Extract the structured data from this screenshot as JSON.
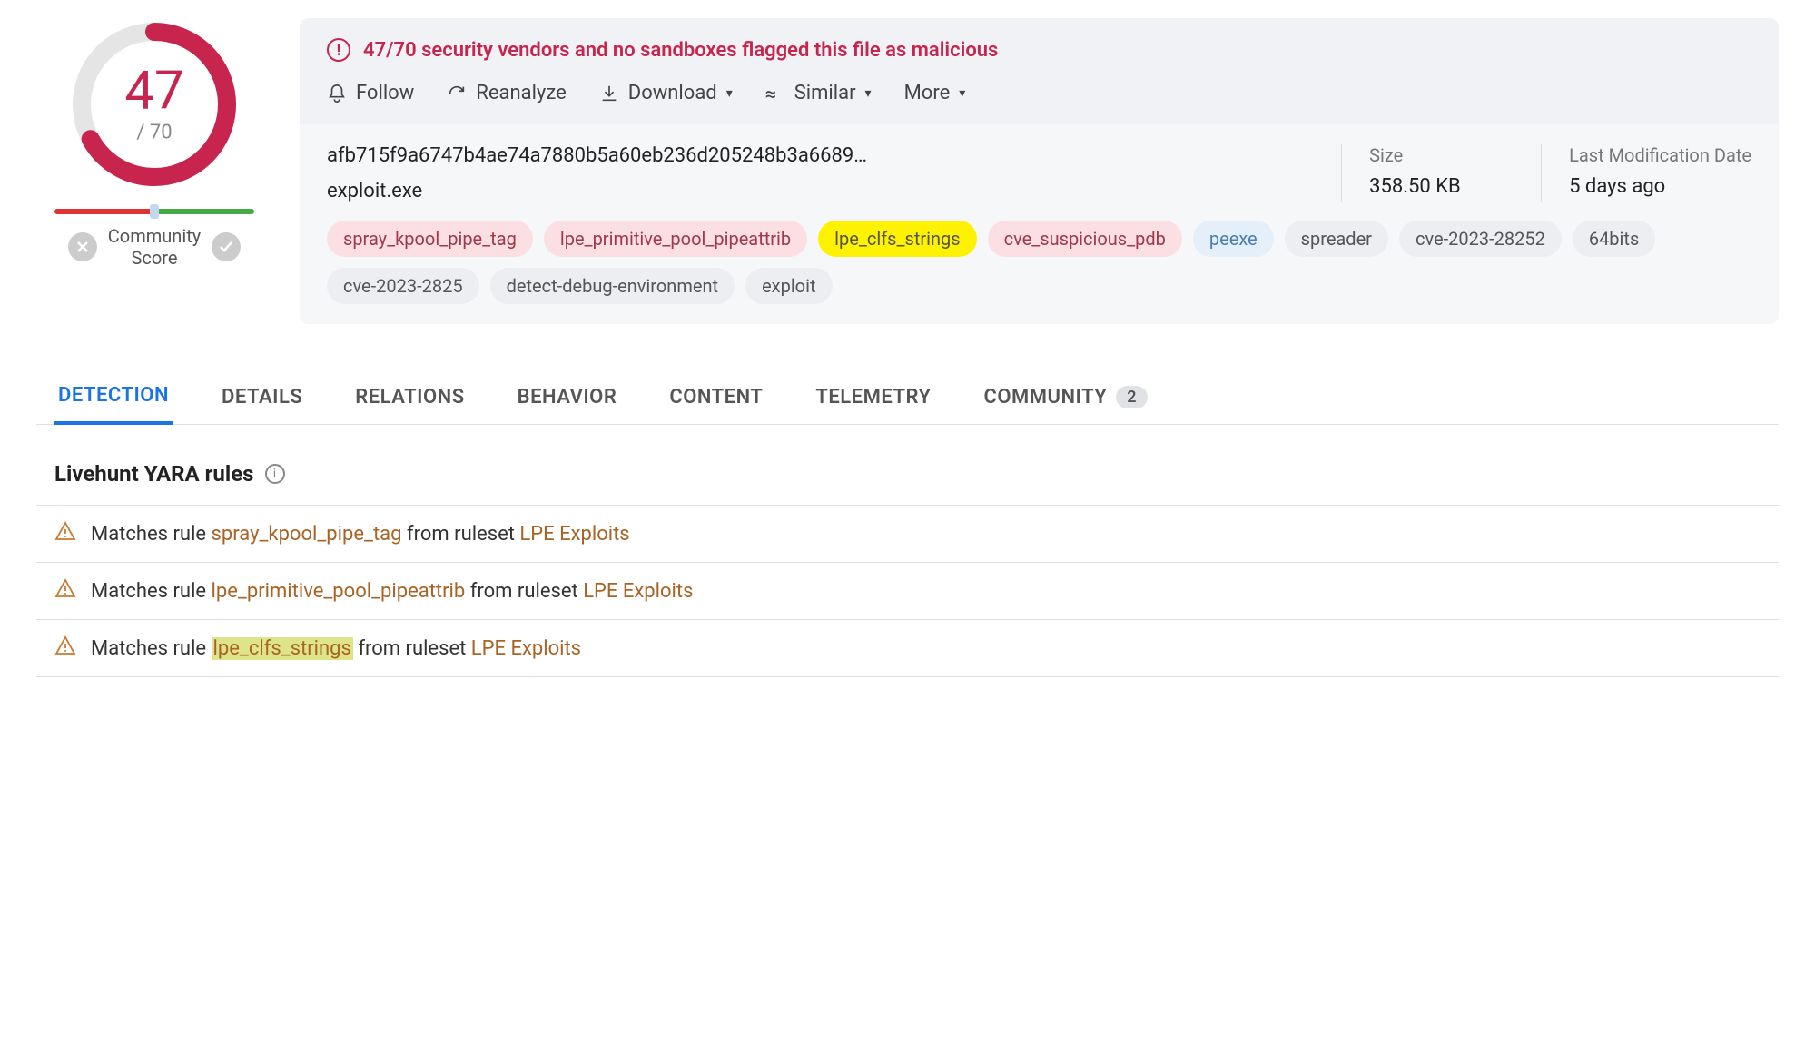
{
  "score": {
    "value": "47",
    "denom": "/ 70"
  },
  "community_label": "Community\nScore",
  "alert_text": "47/70 security vendors and no sandboxes flagged this file as malicious",
  "actions": {
    "follow": "Follow",
    "reanalyze": "Reanalyze",
    "download": "Download",
    "similar": "Similar",
    "more": "More"
  },
  "hash": "afb715f9a6747b4ae74a7880b5a60eb236d205248b3a6689…",
  "filename": "exploit.exe",
  "meta": {
    "size_label": "Size",
    "size_value": "358.50 KB",
    "date_label": "Last Modification Date",
    "date_value": "5 days ago"
  },
  "tags": [
    {
      "text": "spray_kpool_pipe_tag",
      "cls": "red"
    },
    {
      "text": "lpe_primitive_pool_pipeattrib",
      "cls": "red"
    },
    {
      "text": "lpe_clfs_strings",
      "cls": "highlighted"
    },
    {
      "text": "cve_suspicious_pdb",
      "cls": "red"
    },
    {
      "text": "peexe",
      "cls": "blue"
    },
    {
      "text": "spreader",
      "cls": ""
    },
    {
      "text": "cve-2023-28252",
      "cls": ""
    },
    {
      "text": "64bits",
      "cls": ""
    },
    {
      "text": "cve-2023-2825",
      "cls": ""
    },
    {
      "text": "detect-debug-environment",
      "cls": ""
    },
    {
      "text": "exploit",
      "cls": ""
    }
  ],
  "tabs": {
    "detection": "DETECTION",
    "details": "DETAILS",
    "relations": "RELATIONS",
    "behavior": "BEHAVIOR",
    "content": "CONTENT",
    "telemetry": "TELEMETRY",
    "community": "COMMUNITY",
    "community_count": "2"
  },
  "section_title": "Livehunt YARA rules",
  "rules": [
    {
      "prefix": "Matches rule ",
      "rule": "spray_kpool_pipe_tag",
      "mid": " from ruleset ",
      "ruleset": "LPE Exploits",
      "hl": false
    },
    {
      "prefix": "Matches rule ",
      "rule": "lpe_primitive_pool_pipeattrib",
      "mid": " from ruleset ",
      "ruleset": "LPE Exploits",
      "hl": false
    },
    {
      "prefix": "Matches rule ",
      "rule": "lpe_clfs_strings",
      "mid": " from ruleset ",
      "ruleset": "LPE Exploits",
      "hl": true
    }
  ]
}
